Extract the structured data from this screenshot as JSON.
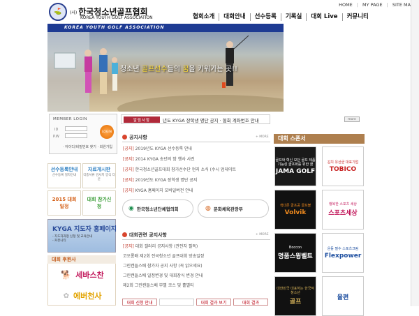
{
  "header": {
    "logo_glyph": "⛳",
    "org_prefix": "(사)",
    "org_name": "한국청소년골프협회",
    "org_english": "KOREA YOUTH GOLF ASSOCIATION",
    "util_links": [
      "HOME",
      "MY PAGE",
      "SITE MAP"
    ],
    "main_nav": [
      "협회소개",
      "대회안내",
      "선수등록",
      "기록실",
      "대회 Live",
      "커뮤니티"
    ]
  },
  "banner": {
    "strip_text": "KOREA YOUTH GOLF ASSOCIATION",
    "tagline_pre": "청소년 ",
    "tagline_hl": "골프선수",
    "tagline_mid": "들의 ",
    "tagline_hl2": "꿈",
    "tagline_post": "을 키워가는 곳!!"
  },
  "login": {
    "title": "MEMBER LOGIN",
    "id_label": "ID",
    "pw_label": "P.W",
    "button": "LOGIN",
    "find_links": "· 아이디/비밀번호 찾기  · 회원가입"
  },
  "quick_tiles": [
    {
      "title": "선수등록안내",
      "sub": "선수등록 절차안내",
      "color": "#2d7fc1"
    },
    {
      "title": "자료게시판",
      "sub": "각종서류 검사지 양식 다운",
      "color": "#2d7fc1"
    },
    {
      "title": "2015 대회일정",
      "sub": "",
      "color": "#d5621a"
    },
    {
      "title": "대회 참가신청",
      "sub": "",
      "color": "#3e9f3b"
    }
  ],
  "kyga_banner": {
    "title": "KYGA 지도자 홍페이지",
    "sub": "- 지도자과정 신청 및 교육안내\n- 커뮤니티"
  },
  "left_sponsors": {
    "heading": "대회 후원사",
    "items": [
      "세바스찬",
      "에버천사"
    ]
  },
  "ticker": {
    "badge": "알림사항",
    "message": "년도 KYGA 장학생 명단 공지   ·   협회 계좌번호 안내"
  },
  "notices": {
    "title": "공지사항",
    "more": "+ MORE",
    "items": [
      {
        "cat": "[공지]",
        "text": "2019년도 KYGA 선수등록 안내"
      },
      {
        "cat": "[공지]",
        "text": "2014 KYGA 송년의 밤 행사 사진"
      },
      {
        "cat": "[공지]",
        "text": "한국청소년골프대회 참가선수단 현지 소식 (수시 업데이트"
      },
      {
        "cat": "[공지]",
        "text": "2019년도 KYGA 장학생 명단 공지"
      },
      {
        "cat": "[공지]",
        "text": "KYGA 홈페이지 모바일버전 안내"
      }
    ]
  },
  "orgs": [
    {
      "name": "한국청소년단체협의회"
    },
    {
      "name": "문화체육관광부"
    }
  ],
  "events": {
    "title": "대회관련 공지사항",
    "more": "+ MORE",
    "items": [
      {
        "cat": "[공지]",
        "text": "대회 갤러리 공지사항 (관전자 필독)"
      },
      {
        "cat": "",
        "text": "코오롱배 제2회 전국청소년 골프대회 방송일정"
      },
      {
        "cat": "",
        "text": "그린캔들스배 참가자 공지 사항 (꼭 읽으세요)"
      },
      {
        "cat": "",
        "text": "그린캔들스배 일정변경 및 대회장식 변경 안내"
      },
      {
        "cat": "",
        "text": "제2회 그린캔들스배 부별 코스 및 홀별티"
      }
    ]
  },
  "bottom_tabs": [
    "대회 신청 안내",
    "",
    "대회 결과 보기",
    "대회 결과"
  ],
  "right_sponsors": {
    "heading": "대회 스폰서",
    "items": [
      {
        "a": "골프와 혁신 모던 골프 제품 기능성 골프화를 위한 꿈",
        "b": "JAMA GOLF",
        "bg": "#1a1a1a",
        "fg": "#ffffff"
      },
      {
        "a": "김치 유산균 대표기업",
        "b": "TOBICO",
        "bg": "#ffffff",
        "fg": "#c71f1f"
      },
      {
        "a": "색다른 골프공 골프볼",
        "b": "Volvik",
        "bg": "#111111",
        "fg": "#f08a1e"
      },
      {
        "a": "행복한 스포츠 세상",
        "b": "스포츠세상",
        "bg": "#ffffff",
        "fg": "#c2185b"
      },
      {
        "a": "Boccon",
        "b": "명품스윙벨트",
        "bg": "#111111",
        "fg": "#ffffff"
      },
      {
        "a": "운동 필수 스포츠크림",
        "b": "Flexpower",
        "bg": "#ffffff",
        "fg": "#1e4fa0"
      },
      {
        "a": "대한민국 대표하는 한국적 청소년",
        "b": "골프",
        "bg": "#111111",
        "fg": "#d8b45a"
      },
      {
        "a": "",
        "b": "올편",
        "bg": "#ffffff",
        "fg": "#1e4fa0"
      }
    ]
  }
}
